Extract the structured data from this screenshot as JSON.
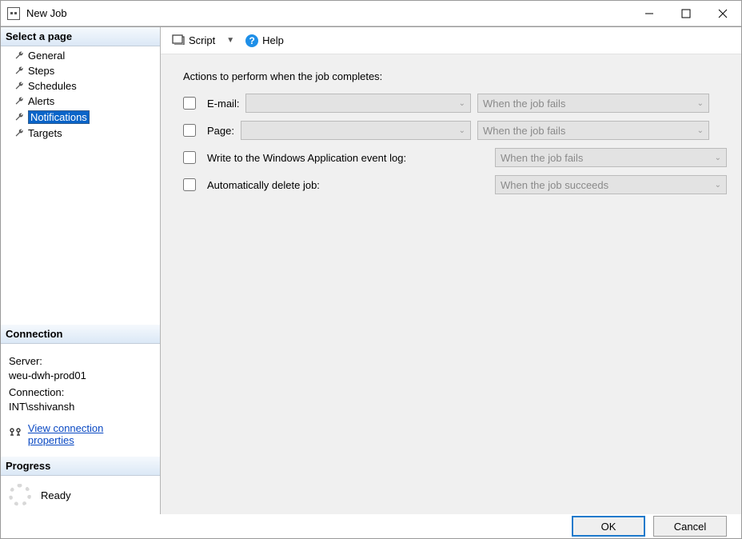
{
  "window": {
    "title": "New Job"
  },
  "sidebar": {
    "select_page": "Select a page",
    "items": [
      {
        "label": "General"
      },
      {
        "label": "Steps"
      },
      {
        "label": "Schedules"
      },
      {
        "label": "Alerts"
      },
      {
        "label": "Notifications",
        "selected": true
      },
      {
        "label": "Targets"
      }
    ],
    "connection": {
      "header": "Connection",
      "server_label": "Server:",
      "server_value": "weu-dwh-prod01",
      "connection_label": "Connection:",
      "connection_value": "INT\\sshivansh",
      "view_props": "View connection properties"
    },
    "progress": {
      "header": "Progress",
      "status": "Ready"
    }
  },
  "toolbar": {
    "script": "Script",
    "help": "Help"
  },
  "main": {
    "instruction": "Actions to perform when the job completes:",
    "rows": [
      {
        "key": "email",
        "label": "E-mail:",
        "has_target_select": true,
        "when": "When the job fails"
      },
      {
        "key": "page",
        "label": "Page:",
        "has_target_select": true,
        "when": "When the job fails"
      },
      {
        "key": "eventlog",
        "label": "Write to the Windows Application event log:",
        "has_target_select": false,
        "when": "When the job fails"
      },
      {
        "key": "autodelete",
        "label": "Automatically delete job:",
        "has_target_select": false,
        "when": "When the job succeeds"
      }
    ]
  },
  "buttons": {
    "ok": "OK",
    "cancel": "Cancel"
  }
}
